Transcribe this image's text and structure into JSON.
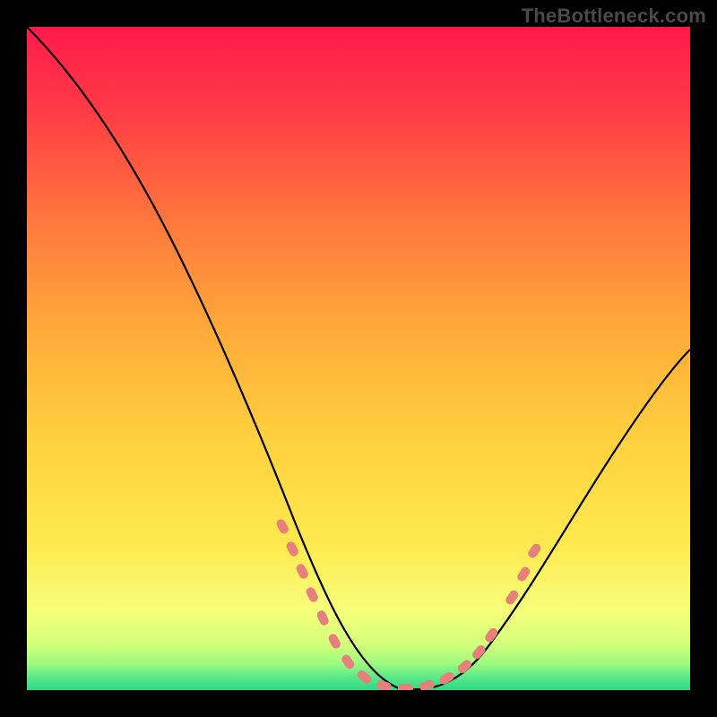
{
  "watermark": "TheBottleneck.com",
  "chart_data": {
    "type": "line",
    "title": "",
    "xlabel": "",
    "ylabel": "",
    "xlim": [
      0,
      100
    ],
    "ylim": [
      0,
      100
    ],
    "grid": false,
    "background_gradient": {
      "top_color": "#ff1a4a",
      "mid_color": "#ffd23f",
      "low_color": "#f6ff7a",
      "bottom_color": "#2bd98a"
    },
    "series": [
      {
        "name": "bottleneck-curve",
        "color": "#000000",
        "x": [
          0,
          4,
          8,
          12,
          16,
          20,
          24,
          28,
          32,
          36,
          40,
          44,
          48,
          52,
          56,
          60,
          64,
          68,
          72,
          76,
          80,
          84,
          88,
          92,
          96,
          100
        ],
        "y": [
          100,
          95,
          89,
          82,
          74,
          65,
          56,
          47,
          38,
          30,
          22,
          15,
          9,
          4,
          1,
          0,
          0,
          1,
          4,
          9,
          15,
          22,
          29,
          36,
          42,
          48
        ]
      }
    ],
    "highlight_markers": {
      "name": "sweet-spot-markers",
      "color": "#e57373",
      "shape": "rounded-dash",
      "points": [
        {
          "x": 38,
          "y": 25
        },
        {
          "x": 40,
          "y": 21
        },
        {
          "x": 41.5,
          "y": 17
        },
        {
          "x": 43,
          "y": 13
        },
        {
          "x": 45,
          "y": 9
        },
        {
          "x": 47,
          "y": 5.5
        },
        {
          "x": 49,
          "y": 3
        },
        {
          "x": 52,
          "y": 1.2
        },
        {
          "x": 55,
          "y": 0.5
        },
        {
          "x": 58,
          "y": 0.3
        },
        {
          "x": 61,
          "y": 0.7
        },
        {
          "x": 64,
          "y": 1.8
        },
        {
          "x": 67,
          "y": 3.5
        },
        {
          "x": 68.5,
          "y": 5.5
        },
        {
          "x": 70,
          "y": 8
        },
        {
          "x": 73,
          "y": 14
        },
        {
          "x": 75,
          "y": 18
        },
        {
          "x": 76.5,
          "y": 22
        }
      ]
    }
  }
}
